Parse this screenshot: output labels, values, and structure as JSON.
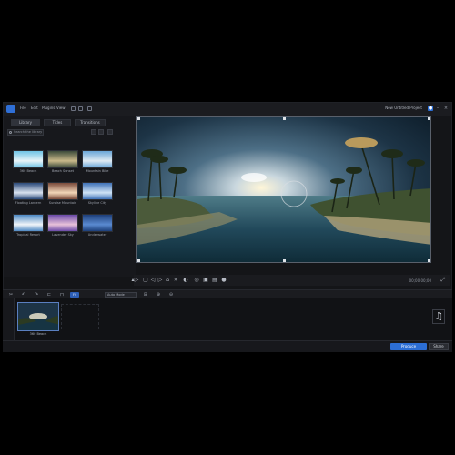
{
  "app": {
    "menu": [
      "File",
      "Edit",
      "Plugins",
      "View"
    ],
    "project_name": "New Untitled Project",
    "window_controls": [
      "minimize",
      "maximize",
      "close"
    ]
  },
  "media_panel": {
    "tabs": [
      "Library",
      "Titles",
      "Transitions"
    ],
    "search": {
      "placeholder": "Search the library"
    },
    "items": [
      {
        "label": "360 Beach",
        "thumb_colors": [
          "#6fc3e6",
          "#e9f4f8"
        ]
      },
      {
        "label": "Beach Sunset",
        "thumb_colors": [
          "#3b4a3a",
          "#c9b98a"
        ]
      },
      {
        "label": "Mountain Bike",
        "thumb_colors": [
          "#6aa6d8",
          "#dfeaf2"
        ]
      },
      {
        "label": "Floating Lantern",
        "thumb_colors": [
          "#2b4a7a",
          "#d9e2ef"
        ]
      },
      {
        "label": "Sunrise Mountain",
        "thumb_colors": [
          "#7a4a3a",
          "#f2d6b8"
        ]
      },
      {
        "label": "Skyline City",
        "thumb_colors": [
          "#3f72b8",
          "#cfe3f5"
        ]
      },
      {
        "label": "Tropical Resort",
        "thumb_colors": [
          "#4e89c4",
          "#f0f4f8"
        ]
      },
      {
        "label": "Lavender Sky",
        "thumb_colors": [
          "#6b4aa8",
          "#e7c1d9"
        ]
      },
      {
        "label": "Underwater",
        "thumb_colors": [
          "#1d3f7a",
          "#5a8ad1"
        ]
      }
    ]
  },
  "player": {
    "controls": [
      "play",
      "stop",
      "prev-frame",
      "next-frame",
      "snapshot",
      "fast-forward",
      "volume",
      "360-view",
      "fit",
      "fullscreen"
    ],
    "timecode": "00;00;00;00"
  },
  "timeline": {
    "tools": [
      "cut",
      "undo",
      "redo",
      "trim",
      "split"
    ],
    "chip_label": "Fit",
    "dropdown_label": "Auto Mode",
    "clip_label": "360 Beach"
  },
  "footer": {
    "produce_label": "Produce",
    "share_label": "Share"
  },
  "colors": {
    "accent": "#2c6ed5",
    "background": "#141518",
    "panel": "#17181c"
  }
}
